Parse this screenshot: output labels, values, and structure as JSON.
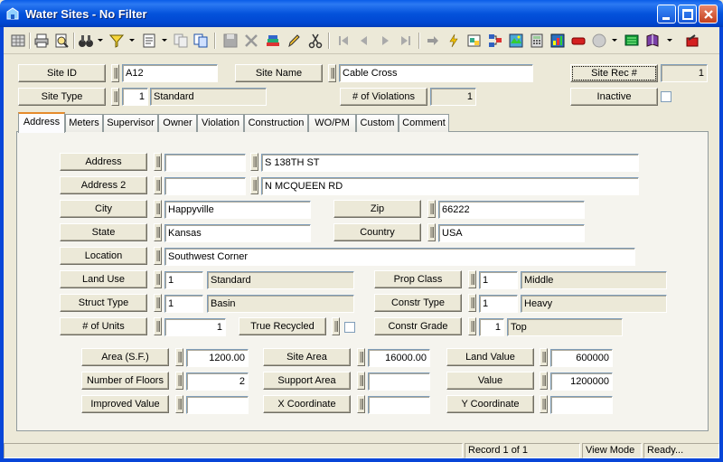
{
  "window": {
    "title": "Water Sites - No Filter",
    "icons": [
      "water-drop-app-icon",
      "minimize-icon",
      "maximize-icon",
      "close-icon"
    ]
  },
  "toolbar": {
    "icons": [
      "grid-view-icon",
      "print-icon",
      "print-preview-icon",
      "binoculars-find-icon",
      "filter-icon",
      "report-icon",
      "copy-record-icon",
      "duplicate-icon",
      "save-icon",
      "delete-icon",
      "books-icon",
      "edit-pencil-icon",
      "cut-scissors-icon",
      "first-record-icon",
      "previous-record-icon",
      "next-record-icon",
      "last-record-icon",
      "goto-icon",
      "quick-action-icon",
      "attach-icon",
      "tree-icon",
      "map-icon",
      "calculator-icon",
      "chart-icon",
      "red-tag-icon",
      "globe-icon",
      "green-monitor-icon",
      "purple-book-icon",
      "exit-icon"
    ]
  },
  "header": {
    "site_id_label": "Site ID",
    "site_id_value": "A12",
    "site_name_label": "Site Name",
    "site_name_value": "Cable Cross",
    "site_rec_label": "Site Rec #",
    "site_rec_value": "1",
    "site_type_label": "Site Type",
    "site_type_code": "1",
    "site_type_value": "Standard",
    "violations_label": "# of Violations",
    "violations_value": "1",
    "inactive_label": "Inactive",
    "inactive_checked": false
  },
  "tabs": [
    "Address",
    "Meters",
    "Supervisor",
    "Owner",
    "Violation",
    "Construction",
    "WO/PM",
    "Custom",
    "Comment"
  ],
  "active_tab": "Address",
  "address": {
    "address_label": "Address",
    "address_prefix": "",
    "address_value": "S 138TH ST",
    "address2_label": "Address 2",
    "address2_prefix": "",
    "address2_value": "N MCQUEEN RD",
    "city_label": "City",
    "city_value": "Happyville",
    "zip_label": "Zip",
    "zip_value": "66222",
    "state_label": "State",
    "state_value": "Kansas",
    "country_label": "Country",
    "country_value": "USA",
    "location_label": "Location",
    "location_value": "Southwest Corner",
    "land_use_label": "Land Use",
    "land_use_code": "1",
    "land_use_value": "Standard",
    "prop_class_label": "Prop Class",
    "prop_class_code": "1",
    "prop_class_value": "Middle",
    "struct_type_label": "Struct Type",
    "struct_type_code": "1",
    "struct_type_value": "Basin",
    "constr_type_label": "Constr Type",
    "constr_type_code": "1",
    "constr_type_value": "Heavy",
    "units_label": "# of Units",
    "units_value": "1",
    "true_recycled_label": "True Recycled",
    "true_recycled_checked": false,
    "constr_grade_label": "Constr Grade",
    "constr_grade_code": "1",
    "constr_grade_value": "Top",
    "area_label": "Area (S.F.)",
    "area_value": "1200.00",
    "site_area_label": "Site Area",
    "site_area_value": "16000.00",
    "land_value_label": "Land Value",
    "land_value_value": "600000",
    "floors_label": "Number of Floors",
    "floors_value": "2",
    "support_area_label": "Support Area",
    "support_area_value": "",
    "value_label": "Value",
    "value_value": "1200000",
    "improved_label": "Improved Value",
    "improved_value": "",
    "xcoord_label": "X Coordinate",
    "xcoord_value": "",
    "ycoord_label": "Y Coordinate",
    "ycoord_value": ""
  },
  "status": {
    "record": "Record 1 of 1",
    "mode": "View Mode",
    "ready": "Ready..."
  }
}
